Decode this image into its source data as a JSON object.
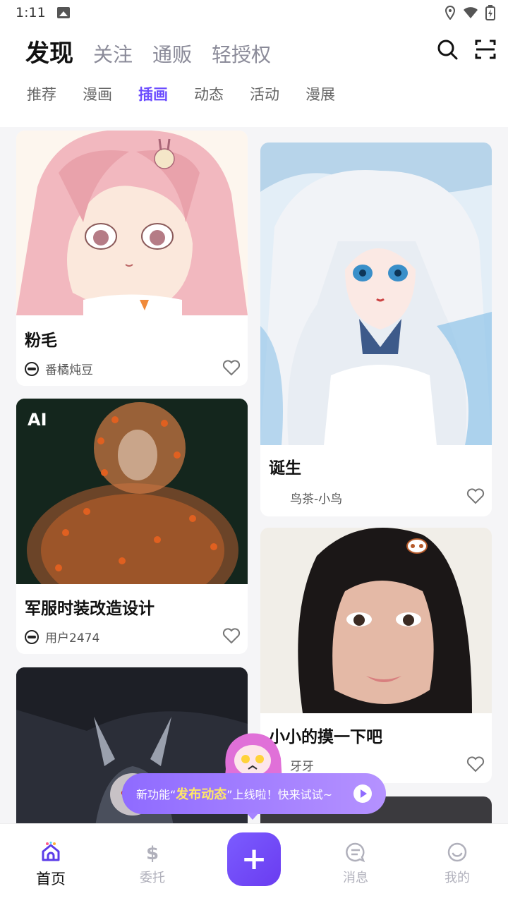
{
  "status_bar": {
    "time": "1:11"
  },
  "top_tabs": [
    {
      "label": "发现",
      "active": true
    },
    {
      "label": "关注"
    },
    {
      "label": "通贩"
    },
    {
      "label": "轻授权"
    }
  ],
  "sub_tabs": [
    {
      "label": "推荐"
    },
    {
      "label": "漫画"
    },
    {
      "label": "插画",
      "active": true
    },
    {
      "label": "动态"
    },
    {
      "label": "活动"
    },
    {
      "label": "漫展"
    }
  ],
  "cards": [
    {
      "title": "粉毛",
      "author": "番橘炖豆"
    },
    {
      "title": "军服时装改造设计",
      "author": "用户2474",
      "badge": "AI"
    },
    {
      "title": "诞生",
      "author": "鸟茶-小鸟"
    },
    {
      "title": "小小的摸一下吧",
      "author": "牙牙"
    }
  ],
  "promo": {
    "prefix": "新功能“",
    "highlight": "发布动态",
    "suffix": "”上线啦！快来试试~"
  },
  "bottom_nav": [
    {
      "label": "首页",
      "icon": "home-icon",
      "active": true
    },
    {
      "label": "委托",
      "icon": "dollar-icon"
    },
    {
      "label": "消息",
      "icon": "message-icon"
    },
    {
      "label": "我的",
      "icon": "smile-icon"
    }
  ],
  "colors": {
    "accent": "#6b4cff",
    "promo_highlight": "#ffe766"
  }
}
